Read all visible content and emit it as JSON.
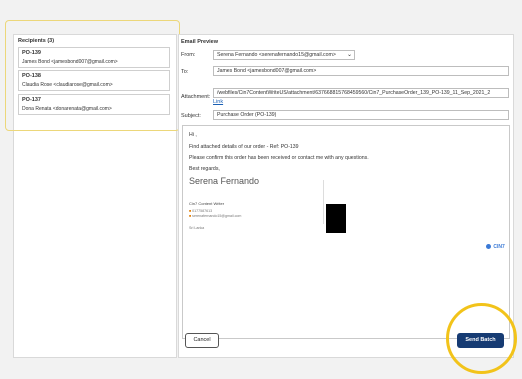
{
  "recipients": {
    "title": "Recipients (3)",
    "items": [
      {
        "po": "PO-139",
        "line": "James Bond <jamesbond007@gmail.com>"
      },
      {
        "po": "PO-138",
        "line": "Claudia Rose <claudiarose@gmail.com>"
      },
      {
        "po": "PO-137",
        "line": "Dona Renata <donarenata@gmail.com>"
      }
    ]
  },
  "preview": {
    "title": "Email Preview",
    "from_label": "From:",
    "from_value": "Serena Fernando <serenafernando15@gmail.com>",
    "to_label": "To:",
    "to_value": "James Bond <jamesbond007@gmail.com>",
    "attachment_label": "Attachment:",
    "attachment_value": "/webfiles/Cin7ContentWriteUS/attachment/637668815768459560/Cin7_PurchaseOrder_139_PO-139_11_Sep_2021_2",
    "link_label": "Link",
    "subject_label": "Subject:",
    "subject_value": "Purchase Order (PO-139)",
    "body": {
      "greeting": "Hi ,",
      "line1": "Find attached details of our order - Ref: PO-139",
      "line2": "Please confirm this order has been received or contact me with any questions.",
      "closing": "Best regards,",
      "signature_name": "Serena Fernando",
      "company": "Cin7 Content Writer",
      "phone": "0177587613",
      "email": "serenafernando15@gmail.com",
      "country": "Sri Lanka"
    },
    "brand": "CIN7"
  },
  "buttons": {
    "cancel": "Cancel",
    "send": "Send Batch"
  },
  "colors": {
    "accent": "#163b73",
    "highlight": "#f2c31a",
    "link": "#1a5fb4"
  }
}
